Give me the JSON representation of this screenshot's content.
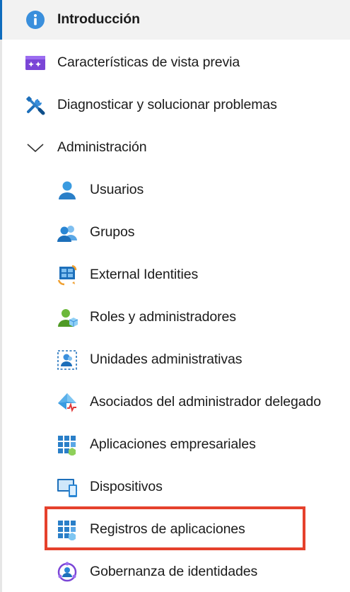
{
  "nav": {
    "items": [
      {
        "label": "Introducción",
        "icon": "info-icon"
      },
      {
        "label": "Características de vista previa",
        "icon": "preview-features-icon"
      },
      {
        "label": "Diagnosticar y solucionar problemas",
        "icon": "wrench-screwdriver-icon"
      },
      {
        "label": "Administración",
        "icon": "chevron-down-icon"
      },
      {
        "label": "Usuarios",
        "icon": "user-icon"
      },
      {
        "label": "Grupos",
        "icon": "groups-icon"
      },
      {
        "label": "External Identities",
        "icon": "external-identities-icon"
      },
      {
        "label": "Roles y administradores",
        "icon": "roles-icon"
      },
      {
        "label": "Unidades administrativas",
        "icon": "administrative-units-icon"
      },
      {
        "label": "Asociados del administrador delegado",
        "icon": "delegated-admin-icon"
      },
      {
        "label": "Aplicaciones empresariales",
        "icon": "enterprise-apps-icon"
      },
      {
        "label": "Dispositivos",
        "icon": "devices-icon"
      },
      {
        "label": "Registros de aplicaciones",
        "icon": "app-registrations-icon"
      },
      {
        "label": "Gobernanza de identidades",
        "icon": "identity-governance-icon"
      }
    ]
  },
  "colors": {
    "accent": "#0f6cbd",
    "highlight": "#e5412c",
    "active_background": "#f2f2f2"
  }
}
